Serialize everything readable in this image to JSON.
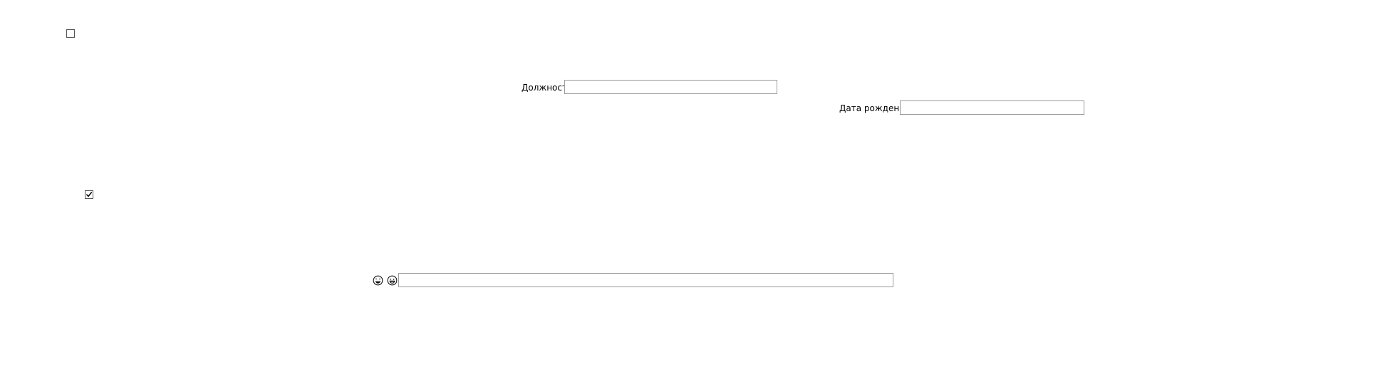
{
  "form": {
    "checkbox_top": {
      "checked": false
    },
    "position": {
      "label": "Должность",
      "value": ""
    },
    "birth_date": {
      "label": "Дата рождения",
      "value": ""
    },
    "checkbox_middle": {
      "checked": true
    },
    "emoji_field": {
      "icons": [
        "laughing-face-icon",
        "grinning-face-icon"
      ],
      "value": ""
    }
  },
  "colors": {
    "border": "#9a9a9a",
    "checkbox_border": "#555555",
    "text": "#000000",
    "background": "#ffffff"
  }
}
